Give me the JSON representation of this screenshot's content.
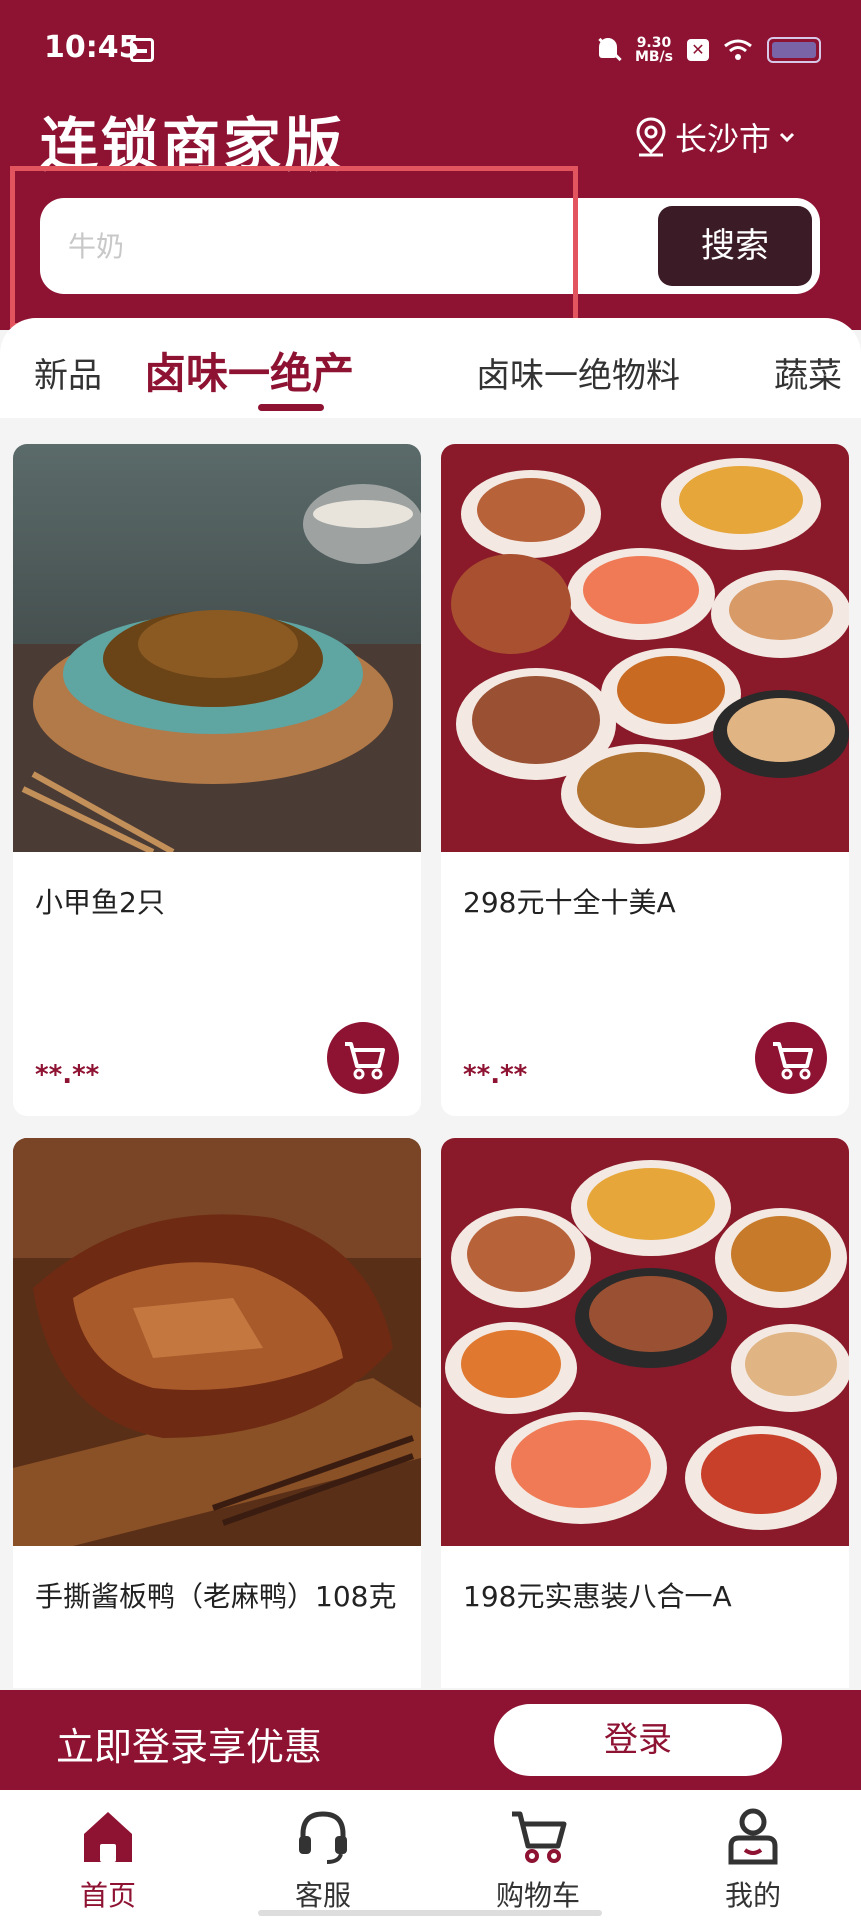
{
  "status_bar": {
    "time": "10:45",
    "net_speed_value": "9.30",
    "net_speed_unit": "MB/s",
    "icons": [
      "calendar-icon",
      "bell-muted-icon",
      "x-icon",
      "wifi-icon",
      "battery-icon"
    ]
  },
  "header": {
    "title": "连锁商家版",
    "city": "长沙市",
    "background_color": "#8e1232"
  },
  "search": {
    "placeholder": "牛奶",
    "button_label": "搜索"
  },
  "tabs": [
    {
      "label": "新品",
      "active": false
    },
    {
      "label": "卤味一绝产",
      "active": true
    },
    {
      "label": "卤味一绝物料",
      "active": false
    },
    {
      "label": "蔬菜",
      "active": false
    }
  ],
  "products": [
    {
      "name": "小甲鱼2只",
      "price": "**.**",
      "image": "braised-turtle-in-clay-pot"
    },
    {
      "name": "298元十全十美A",
      "price": "**.**",
      "image": "ten-dish-braised-platter"
    },
    {
      "name": "手撕酱板鸭（老麻鸭）108克",
      "price": "",
      "image": "shredded-sauce-duck"
    },
    {
      "name": "198元实惠装八合一A",
      "price": "",
      "image": "eight-dish-braised-platter"
    }
  ],
  "login_banner": {
    "text": "立即登录享优惠",
    "button_label": "登录"
  },
  "bottom_nav": [
    {
      "label": "首页",
      "icon": "home-icon",
      "active": true
    },
    {
      "label": "客服",
      "icon": "headset-icon",
      "active": false
    },
    {
      "label": "购物车",
      "icon": "cart-icon",
      "active": false
    },
    {
      "label": "我的",
      "icon": "profile-icon",
      "active": false
    }
  ],
  "colors": {
    "brand": "#8e1232",
    "search_button": "#3b1c26",
    "highlight_outline": "#e2555e"
  }
}
